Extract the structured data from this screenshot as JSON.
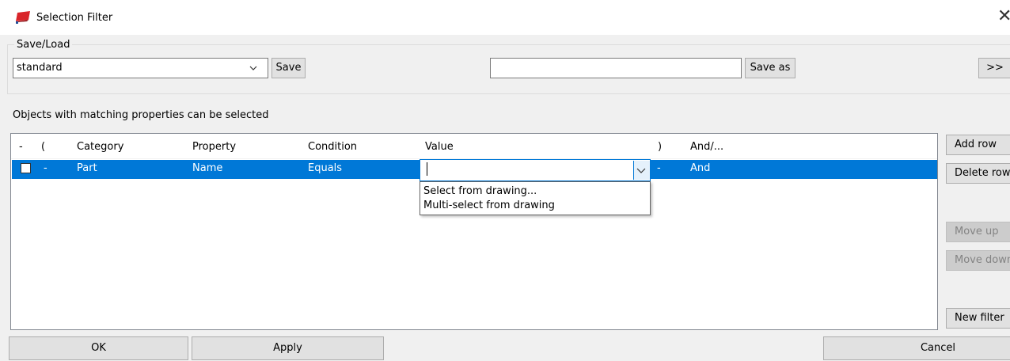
{
  "window": {
    "title": "Selection Filter",
    "close_glyph": "✕"
  },
  "save_load": {
    "legend": "Save/Load",
    "filter_combo_value": "standard",
    "save_label": "Save",
    "name_input_value": "",
    "save_as_label": "Save as",
    "expand_label": ">>"
  },
  "info_text": "Objects with matching properties can be selected",
  "table": {
    "headers": [
      "-",
      "(",
      "Category",
      "Property",
      "Condition",
      "Value",
      ")",
      "And/..."
    ],
    "rows": [
      {
        "checked": false,
        "dash": "-",
        "category": "Part",
        "property": "Name",
        "condition": "Equals",
        "value": "",
        "close_paren": "-",
        "and_or": "And"
      }
    ]
  },
  "value_dropdown": {
    "options": [
      "Select from drawing...",
      "Multi-select from drawing"
    ]
  },
  "side_buttons": {
    "add_row": "Add row",
    "delete_row": "Delete row",
    "move_up": "Move up",
    "move_down": "Move down",
    "new_filter": "New filter"
  },
  "bottom_buttons": {
    "ok": "OK",
    "apply": "Apply",
    "cancel": "Cancel"
  },
  "colors": {
    "selection": "#0078d7",
    "accent": "#0078d7",
    "brand_icon": "#d9252a"
  },
  "icons": [
    "tekla-app-icon",
    "close-icon",
    "chevron-down-icon"
  ]
}
